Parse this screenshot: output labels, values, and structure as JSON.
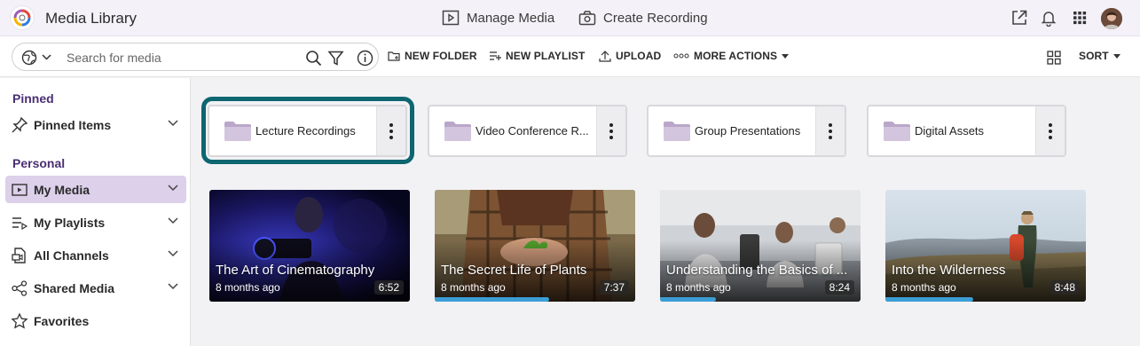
{
  "app": {
    "title": "Media Library",
    "manage_media": "Manage Media",
    "create_recording": "Create Recording"
  },
  "toolbar": {
    "search_placeholder": "Search for media",
    "new_folder": "NEW FOLDER",
    "new_playlist": "NEW PLAYLIST",
    "upload": "UPLOAD",
    "more_actions": "MORE ACTIONS",
    "sort": "SORT"
  },
  "sidebar": {
    "pinned_label": "Pinned",
    "personal_label": "Personal",
    "items": [
      {
        "label": "Pinned Items",
        "icon": "pin-icon"
      },
      {
        "label": "My Media",
        "icon": "media-icon",
        "active": true
      },
      {
        "label": "My Playlists",
        "icon": "playlist-icon"
      },
      {
        "label": "All Channels",
        "icon": "channels-icon"
      },
      {
        "label": "Shared Media",
        "icon": "share-icon"
      },
      {
        "label": "Favorites",
        "icon": "star-icon"
      }
    ]
  },
  "folders": [
    {
      "name": "Lecture Recordings",
      "focused": true
    },
    {
      "name": "Video Conference R..."
    },
    {
      "name": "Group Presentations"
    },
    {
      "name": "Digital Assets"
    }
  ],
  "media": [
    {
      "title": "The Art of Cinematography",
      "age": "8 months ago",
      "duration": "6:52",
      "progress": 0
    },
    {
      "title": "The Secret Life of Plants",
      "age": "8 months ago",
      "duration": "7:37",
      "progress": 0.57
    },
    {
      "title": "Understanding the Basics of ...",
      "age": "8 months ago",
      "duration": "8:24",
      "progress": 0.28
    },
    {
      "title": "Into the Wilderness",
      "age": "8 months ago",
      "duration": "8:48",
      "progress": 0.44
    }
  ],
  "colors": {
    "accent_purple": "#4a2f73",
    "active_nav": "#dcd0ea",
    "focus_ring": "#0d6670",
    "progress": "#3c9ed6"
  }
}
